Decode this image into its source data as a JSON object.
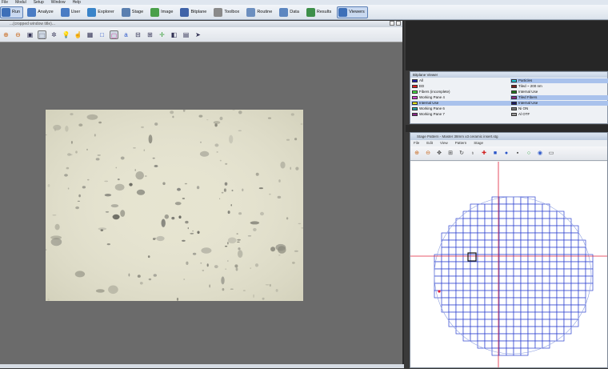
{
  "menubar": {
    "items": [
      "File",
      "Modul",
      "Setup",
      "Window",
      "Help"
    ]
  },
  "toolbar": {
    "buttons": [
      {
        "label": "Run",
        "icon": "run-icon",
        "color": "#3d6fb8",
        "active": true
      },
      {
        "label": "Analyze",
        "icon": "analyze-icon",
        "color": "#4a7cc4",
        "active": false
      },
      {
        "label": "User",
        "icon": "user-icon",
        "color": "#4a7cc4",
        "active": false
      },
      {
        "label": "Explorer",
        "icon": "explorer-icon",
        "color": "#3a84c9",
        "active": false
      },
      {
        "label": "Stage",
        "icon": "stage-icon",
        "color": "#5a7fb0",
        "active": false
      },
      {
        "label": "Image",
        "icon": "image-icon",
        "color": "#4aa04a",
        "active": false
      },
      {
        "label": "Bitplane",
        "icon": "bitplane-icon",
        "color": "#3f63a8",
        "active": false
      },
      {
        "label": "Toolbox",
        "icon": "toolbox-icon",
        "color": "#8a8a8a",
        "active": false
      },
      {
        "label": "Routine",
        "icon": "routine-icon",
        "color": "#6c8fbf",
        "active": false
      },
      {
        "label": "Data",
        "icon": "data-icon",
        "color": "#5c86c0",
        "active": false
      },
      {
        "label": "Results",
        "icon": "results-icon",
        "color": "#3d8f4a",
        "active": false
      },
      {
        "label": "Viewers",
        "icon": "viewers-icon",
        "color": "#3d6fb8",
        "active": true
      }
    ]
  },
  "viewer": {
    "title": "...(cropped window title)...",
    "tools": [
      "zoom-in-icon",
      "zoom-out-icon",
      "fit-icon",
      "select-icon",
      "settings-icon",
      "bulb-icon",
      "pointer-icon",
      "image-mode-icon",
      "rect-blue-icon",
      "rect-pink-icon",
      "text-label-icon",
      "measure-icon",
      "crop-icon",
      "crosshair-icon",
      "layers-icon",
      "screenshot-icon",
      "arrow-icon"
    ]
  },
  "bitplane_viewer": {
    "title": "Bitplane Viewer",
    "rows": [
      {
        "label": "All",
        "color": "#2222aa",
        "highlight": false
      },
      {
        "label": "Particles",
        "color": "#22c8d8",
        "highlight": true
      },
      {
        "label": "ED",
        "color": "#e02020",
        "highlight": false
      },
      {
        "label": "Tiled ~ 200 nm",
        "color": "#7a1f1f",
        "highlight": false
      },
      {
        "label": "Fibers (incomplete)",
        "color": "#44dd44",
        "highlight": false
      },
      {
        "label": "Internal Use",
        "color": "#1f7a1f",
        "highlight": false
      },
      {
        "label": "Working Pane 4",
        "color": "#d23cd2",
        "highlight": false
      },
      {
        "label": "Tiled Fibers",
        "color": "#8a2a8a",
        "highlight": true
      },
      {
        "label": "Internal Use",
        "color": "#e0e020",
        "highlight": true
      },
      {
        "label": "Internal Use",
        "color": "#1a1a6a",
        "highlight": true
      },
      {
        "label": "Working Pane 6",
        "color": "#20a0a0",
        "highlight": false
      },
      {
        "label": "Ni ON",
        "color": "#777777",
        "highlight": false
      },
      {
        "label": "Working Pane 7",
        "color": "#8a2a8a",
        "highlight": false
      },
      {
        "label": "Al OTF",
        "color": "#999999",
        "highlight": false
      }
    ]
  },
  "stage_pattern": {
    "title": "Stage Pattern - Master 38mm x3 ceramic insert.stg",
    "menu": [
      "File",
      "Edit",
      "View",
      "Pattern",
      "Stage"
    ],
    "tools": [
      "zoom-in-icon",
      "zoom-out-icon",
      "pan-icon",
      "grid-icon",
      "rotate-icon",
      "probe-icon",
      "add-point-icon",
      "square-icon",
      "stop-icon",
      "fill-square-icon",
      "circle-icon",
      "record-icon",
      "window-icon"
    ],
    "grid_color": "#2a3fcf",
    "crosshair_color": "#e0203a",
    "tile_count_per_row": 23
  }
}
